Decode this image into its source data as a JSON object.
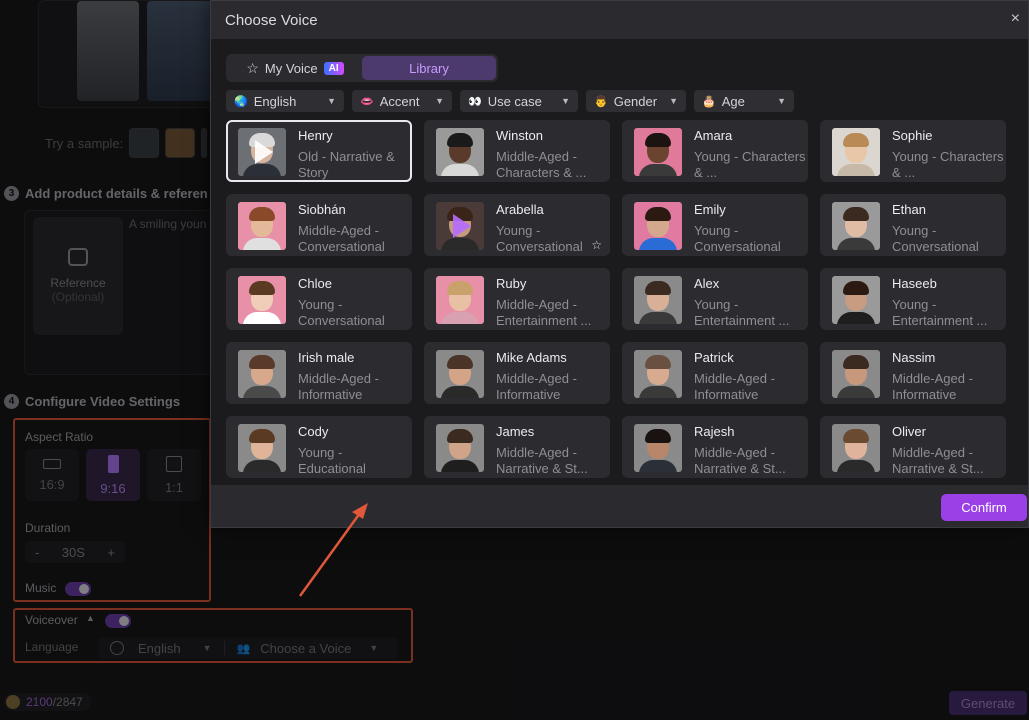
{
  "background": {
    "sample_label": "Try a sample:",
    "step3": {
      "num": "3",
      "title": "Add product details & referen"
    },
    "reference_tile": {
      "label": "Reference",
      "sub": "(Optional)"
    },
    "details_placeholder": "A smiling youn",
    "step4": {
      "num": "4",
      "title": "Configure Video Settings"
    },
    "aspect_ratio": {
      "label": "Aspect Ratio",
      "options": [
        "16:9",
        "9:16",
        "1:1"
      ],
      "selected": "9:16"
    },
    "duration": {
      "label": "Duration",
      "minus": "-",
      "value": "30S",
      "plus": "+"
    },
    "music": {
      "label": "Music",
      "on": true
    },
    "voiceover": {
      "label": "Voiceover",
      "caret": "▲",
      "on": true,
      "language_label": "Language",
      "language_value": "English",
      "voice_placeholder": "Choose a Voice"
    },
    "credits": {
      "used": "2100",
      "total": "/2847"
    },
    "generate_label": "Generate"
  },
  "modal": {
    "title": "Choose Voice",
    "close": "×",
    "tabs": [
      {
        "label": "My Voice",
        "badge": "AI",
        "active": false
      },
      {
        "label": "Library",
        "active": true
      }
    ],
    "filters": [
      {
        "icon": "🌏",
        "label": "English"
      },
      {
        "icon": "👄",
        "label": "Accent"
      },
      {
        "icon": "👀",
        "label": "Use case"
      },
      {
        "icon": "👨",
        "label": "Gender"
      },
      {
        "icon": "🎂",
        "label": "Age"
      }
    ],
    "voices": [
      {
        "name": "Henry",
        "desc": "Old - Narrative & Story",
        "selected": true,
        "play": "white",
        "skin": "#d6b59e",
        "hair": "#d9d9d9",
        "bg": "#6c6f74",
        "shirt": "#2b2f38"
      },
      {
        "name": "Winston",
        "desc": "Middle-Aged - Characters & ...",
        "skin": "#5a3a2a",
        "hair": "#1a1a1a",
        "bg": "#9a9a9a",
        "shirt": "#d8d8d8"
      },
      {
        "name": "Amara",
        "desc": "Young - Characters & ...",
        "skin": "#6b4430",
        "hair": "#1c1410",
        "bg": "#e07a9a",
        "shirt": "#3a3a3a"
      },
      {
        "name": "Sophie",
        "desc": "Young - Characters & ...",
        "skin": "#e8c6a8",
        "hair": "#b98a55",
        "bg": "#dcd6d0",
        "shirt": "#c7b9a8"
      },
      {
        "name": "Siobhán",
        "desc": "Middle-Aged - Conversational",
        "skin": "#e4b99a",
        "hair": "#8a4a2a",
        "bg": "#e890a8",
        "shirt": "#e0e0e0"
      },
      {
        "name": "Arabella",
        "desc": "Young - Conversational",
        "play": "purple",
        "star": true,
        "skin": "#c49a80",
        "hair": "#3a2418",
        "bg": "#4a3a38",
        "shirt": "#2a2a2a"
      },
      {
        "name": "Emily",
        "desc": "Young - Conversational",
        "skin": "#d3a88c",
        "hair": "#2a1a12",
        "bg": "#e07aa0",
        "shirt": "#2a6bd6"
      },
      {
        "name": "Ethan",
        "desc": "Young - Conversational",
        "skin": "#e0bca4",
        "hair": "#3a2a20",
        "bg": "#9a9a9a",
        "shirt": "#3a3a3a"
      },
      {
        "name": "Chloe",
        "desc": "Young - Conversational",
        "skin": "#f0cdb8",
        "hair": "#5a3a22",
        "bg": "#e890a8",
        "shirt": "#ffffff"
      },
      {
        "name": "Ruby",
        "desc": "Middle-Aged - Entertainment ...",
        "skin": "#e8c0a4",
        "hair": "#c9a16a",
        "bg": "#e890a8",
        "shirt": "#d8a0b0"
      },
      {
        "name": "Alex",
        "desc": "Young - Entertainment ...",
        "skin": "#d8b098",
        "hair": "#3a2a20",
        "bg": "#8a8a8a",
        "shirt": "#3a3a3a"
      },
      {
        "name": "Haseeb",
        "desc": "Young - Entertainment ...",
        "skin": "#c89c80",
        "hair": "#2a1a12",
        "bg": "#9a9a9a",
        "shirt": "#1e1e1e"
      },
      {
        "name": "Irish male",
        "desc": "Middle-Aged - Informative",
        "skin": "#d8a88c",
        "hair": "#5a3a2a",
        "bg": "#8a8a8a",
        "shirt": "#4a4a4a"
      },
      {
        "name": "Mike Adams",
        "desc": "Middle-Aged - Informative",
        "skin": "#d4a488",
        "hair": "#4a3428",
        "bg": "#8a8a8a",
        "shirt": "#2a2a2a"
      },
      {
        "name": "Patrick",
        "desc": "Middle-Aged - Informative",
        "skin": "#d8aa90",
        "hair": "#6a5040",
        "bg": "#8a8a8a",
        "shirt": "#3a3a3a"
      },
      {
        "name": "Nassim",
        "desc": "Middle-Aged - Informative",
        "skin": "#c8987c",
        "hair": "#3a2a20",
        "bg": "#8a8a8a",
        "shirt": "#3a3a3a"
      },
      {
        "name": "Cody",
        "desc": "Young - Educational",
        "skin": "#e0b498",
        "hair": "#5a3a22",
        "bg": "#8a8a8a",
        "shirt": "#2a2a2a"
      },
      {
        "name": "James",
        "desc": "Middle-Aged - Narrative & St...",
        "skin": "#d0a488",
        "hair": "#3a2a20",
        "bg": "#8a8a8a",
        "shirt": "#1e1e1e"
      },
      {
        "name": "Rajesh",
        "desc": "Middle-Aged - Narrative & St...",
        "skin": "#b8866a",
        "hair": "#1a1210",
        "bg": "#8a8a8a",
        "shirt": "#2a2f38"
      },
      {
        "name": "Oliver",
        "desc": "Middle-Aged - Narrative & St...",
        "skin": "#e0b49c",
        "hair": "#6a4a30",
        "bg": "#8a8a8a",
        "shirt": "#2a2a2a"
      }
    ],
    "confirm_label": "Confirm"
  },
  "colors": {
    "accent": "#9b40e6",
    "annotation": "#e0573a",
    "selected_border": "#e8e8ee"
  }
}
